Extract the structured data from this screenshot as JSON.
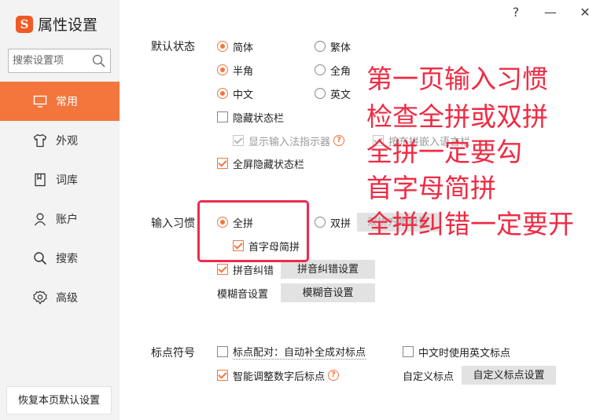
{
  "app": {
    "title": "属性设置",
    "logo_letter": "S"
  },
  "window": {
    "help": "?",
    "minimize": "—",
    "close": "✕"
  },
  "search": {
    "placeholder": "搜索设置项"
  },
  "sidebar": {
    "items": [
      {
        "label": "常用",
        "icon": "monitor-icon",
        "active": true
      },
      {
        "label": "外观",
        "icon": "shirt-icon",
        "active": false
      },
      {
        "label": "词库",
        "icon": "book-icon",
        "active": false
      },
      {
        "label": "账户",
        "icon": "user-icon",
        "active": false
      },
      {
        "label": "搜索",
        "icon": "search-icon",
        "active": false
      },
      {
        "label": "高级",
        "icon": "gear-icon",
        "active": false
      }
    ],
    "restore_label": "恢复本页默认设置"
  },
  "default_state": {
    "label": "默认状态",
    "simplified": "简体",
    "traditional": "繁体",
    "half_width": "半角",
    "full_width": "全角",
    "chinese": "中文",
    "english": "英文",
    "hide_status_bar": "隐藏状态栏",
    "show_indicator": "显示输入法指示器",
    "embedded_input": "按东拼嵌入语言栏",
    "fullscreen_hide": "全屏隐藏状态栏"
  },
  "input_habit": {
    "label": "输入习惯",
    "quanpin": "全拼",
    "shuangpin": "双拼",
    "shuangpin_settings": "双拼方案设置",
    "initials": "首字母简拼",
    "correction": "拼音纠错",
    "correction_settings": "拼音纠错设置",
    "fuzzy": "模糊音设置",
    "fuzzy_settings": "模糊音设置"
  },
  "punctuation": {
    "label": "标点符号",
    "pairing": "标点配对：自动补全成对标点",
    "english_in_chinese": "中文时使用英文标点",
    "smart_adjust": "智能调整数字后标点",
    "custom": "自定义标点",
    "custom_settings": "自定义标点设置"
  },
  "annotations": {
    "line1": "第一页输入习惯",
    "line2": "检查全拼或双拼",
    "line3": "全拼一定要勾",
    "line4": "首字母简拼",
    "line5": "全拼纠错一定要开"
  },
  "colors": {
    "accent": "#f3763d",
    "annotation": "#ef2b43"
  }
}
